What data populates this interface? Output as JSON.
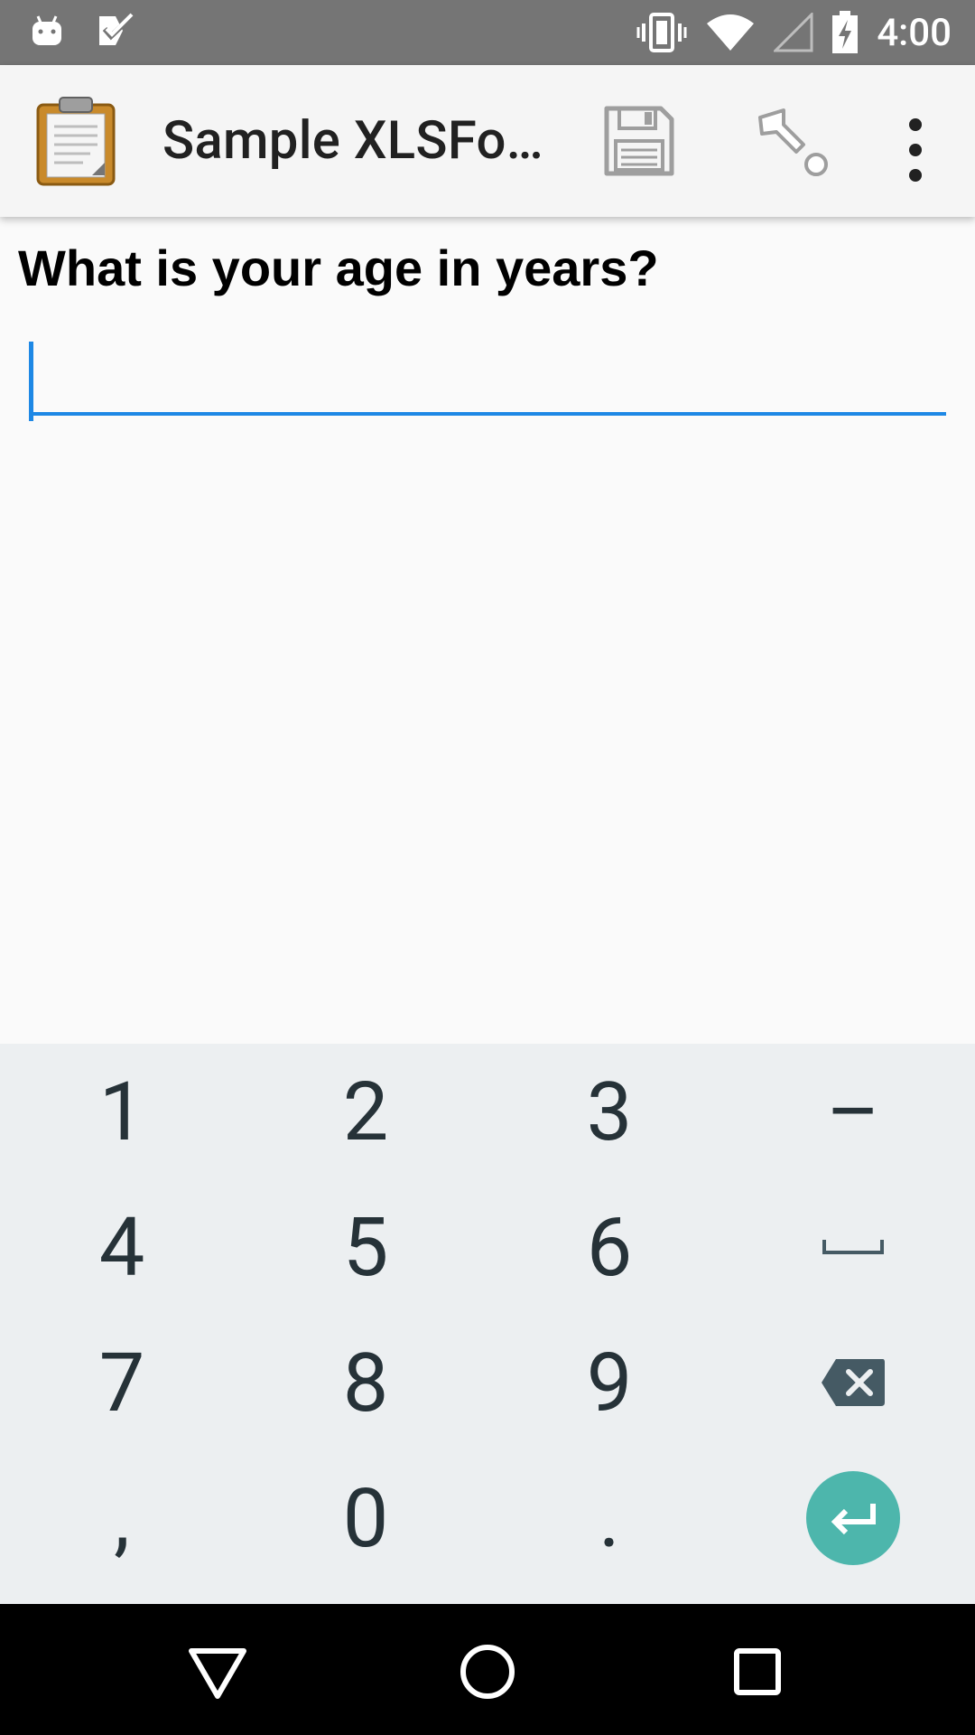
{
  "status_bar": {
    "time": "4:00",
    "icons": [
      "android-icon",
      "check-task-icon",
      "vibrate-icon",
      "wifi-icon",
      "signal-icon",
      "battery-charging-icon"
    ]
  },
  "app_bar": {
    "title": "Sample XLSFo…",
    "icons": [
      "clipboard-logo-icon",
      "save-icon",
      "goto-icon",
      "more-vert-icon"
    ]
  },
  "form": {
    "question": "What is your age in years?",
    "answer_value": "",
    "accent_color": "#1e88e5"
  },
  "keyboard": {
    "rows": [
      [
        "1",
        "2",
        "3",
        "–"
      ],
      [
        "4",
        "5",
        "6",
        "space"
      ],
      [
        "7",
        "8",
        "9",
        "delete"
      ],
      [
        ",",
        "0",
        ".",
        "enter"
      ]
    ],
    "keys": {
      "k1": "1",
      "k2": "2",
      "k3": "3",
      "k_dash": "–",
      "k4": "4",
      "k5": "5",
      "k6": "6",
      "k7": "7",
      "k8": "8",
      "k9": "9",
      "k_comma": ",",
      "k0": "0",
      "k_period": "."
    },
    "enter_color": "#4db6ac"
  },
  "nav_bar": {
    "icons": [
      "back-triangle-icon",
      "home-circle-icon",
      "recents-square-icon"
    ]
  }
}
